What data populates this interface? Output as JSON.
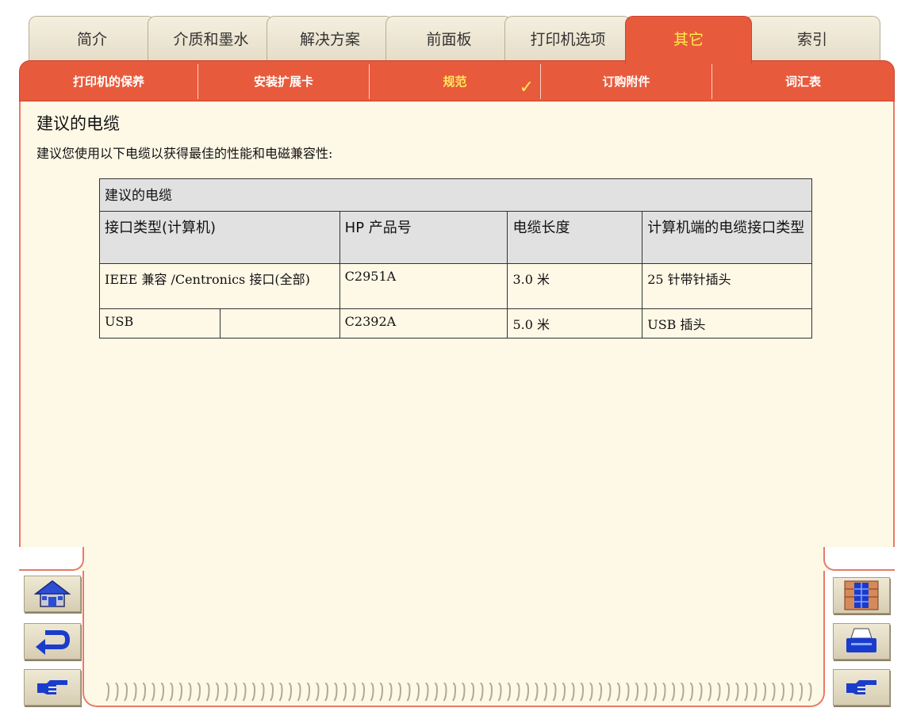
{
  "tabs": [
    {
      "label": "简介",
      "active": false
    },
    {
      "label": "介质和墨水",
      "active": false
    },
    {
      "label": "解决方案",
      "active": false
    },
    {
      "label": "前面板",
      "active": false
    },
    {
      "label": "打印机选项",
      "active": false
    },
    {
      "label": "其它",
      "active": true
    },
    {
      "label": "索引",
      "active": false
    }
  ],
  "subtabs": [
    {
      "label": "打印机的保养",
      "active": false
    },
    {
      "label": "安装扩展卡",
      "active": false
    },
    {
      "label": "规范",
      "active": true,
      "check": "✓"
    },
    {
      "label": "订购附件",
      "active": false
    },
    {
      "label": "词汇表",
      "active": false
    }
  ],
  "page": {
    "title": "建议的电缆",
    "intro": "建议您使用以下电缆以获得最佳的性能和电磁兼容性:"
  },
  "table": {
    "caption": "建议的电缆",
    "headers": [
      "接口类型(计算机)",
      "HP 产品号",
      "电缆长度",
      "计算机端的电缆接口类型"
    ],
    "rows": [
      [
        "IEEE 兼容 /Centronics 接口(全部)",
        "C2951A",
        "3.0 米",
        "25 针带针插头"
      ],
      [
        "USB",
        "C2392A",
        "5.0 米",
        "USB 插头"
      ]
    ]
  },
  "nav": {
    "left": [
      {
        "name": "home-button",
        "icon": "home-icon"
      },
      {
        "name": "back-button",
        "icon": "return-arrow-icon"
      },
      {
        "name": "forward-button",
        "icon": "pointing-hand-icon"
      }
    ],
    "right": [
      {
        "name": "contents-button",
        "icon": "grid-icon"
      },
      {
        "name": "print-button",
        "icon": "printer-icon"
      },
      {
        "name": "next-page-button",
        "icon": "pointing-hand-icon"
      }
    ]
  },
  "colors": {
    "accent": "#e85a3c",
    "active_text": "#ffe85a",
    "page_bg": "#fef8e6",
    "tab_bg": "#efe9d4",
    "icon_blue": "#1a3ccc"
  }
}
